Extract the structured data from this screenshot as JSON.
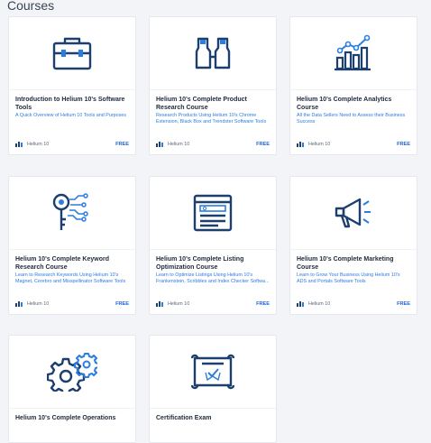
{
  "page": {
    "heading": "Courses"
  },
  "courses": [
    {
      "title": "Introduction to Helium 10's Software Tools",
      "description": "A Quick Overview of Helium 10 Tools and Purposes",
      "brand": "Helium 10",
      "price": "FREE",
      "icon": "toolbox-icon"
    },
    {
      "title": "Helium 10's Complete Product Research Course",
      "description": "Research Products Using Helium 10's Chrome Extension, Black Box and Trendster Software Tools",
      "brand": "Helium 10",
      "price": "FREE",
      "icon": "binoculars-icon"
    },
    {
      "title": "Helium 10's Complete Analytics Course",
      "description": "All the Data Sellers Need to Assess their Business Success",
      "brand": "Helium 10",
      "price": "FREE",
      "icon": "growth-chart-icon"
    },
    {
      "title": "Helium 10's Complete Keyword Research Course",
      "description": "Learn to Research Keywords Using Helium 10's Magnet, Cerebro and Misspellinator Software Tools",
      "brand": "Helium 10",
      "price": "FREE",
      "icon": "key-circuit-icon"
    },
    {
      "title": "Helium 10's Complete Listing Optimization Course",
      "description": "Learn to Optimize Listings Using Helium 10's Frankenstein, Scribbles and Index Checker Softwa...",
      "brand": "Helium 10",
      "price": "FREE",
      "icon": "browser-search-icon"
    },
    {
      "title": "Helium 10's Complete Marketing Course",
      "description": "Learn to Grow Your Business Using Helium 10's ADS and Portals Software Tools",
      "brand": "Helium 10",
      "price": "FREE",
      "icon": "megaphone-icon"
    },
    {
      "title": "Helium 10's Complete Operations",
      "description": "",
      "brand": "",
      "price": "",
      "icon": "gears-icon"
    },
    {
      "title": "Certification Exam",
      "description": "",
      "brand": "",
      "price": "",
      "icon": "certificate-scroll-icon"
    }
  ],
  "colors": {
    "icon_dark": "#1d3f6e",
    "icon_accent": "#2a7de1",
    "link": "#2c7be5",
    "price": "#1a62d8"
  }
}
